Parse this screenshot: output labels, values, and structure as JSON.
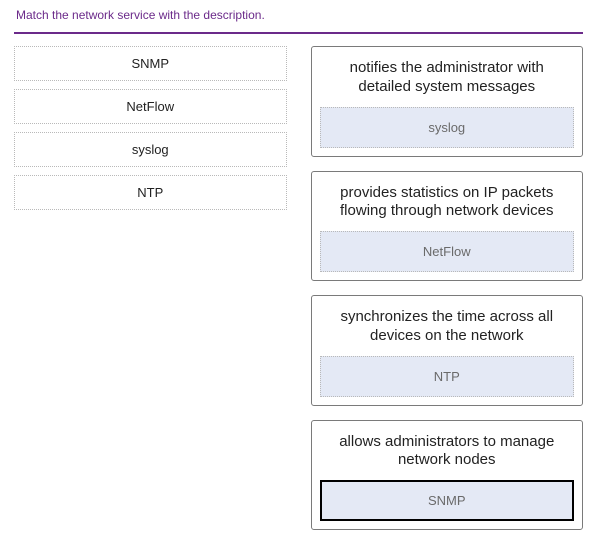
{
  "instruction": "Match the network service with the description.",
  "sources": [
    {
      "label": "SNMP"
    },
    {
      "label": "NetFlow"
    },
    {
      "label": "syslog"
    },
    {
      "label": "NTP"
    }
  ],
  "targets": [
    {
      "description": "notifies the administrator with detailed system messages",
      "answer": "syslog",
      "selected": false
    },
    {
      "description": "provides statistics on IP packets flowing through network devices",
      "answer": "NetFlow",
      "selected": false
    },
    {
      "description": "synchronizes the time across all devices on the network",
      "answer": "NTP",
      "selected": false
    },
    {
      "description": "allows administrators to manage network nodes",
      "answer": "SNMP",
      "selected": true
    }
  ]
}
